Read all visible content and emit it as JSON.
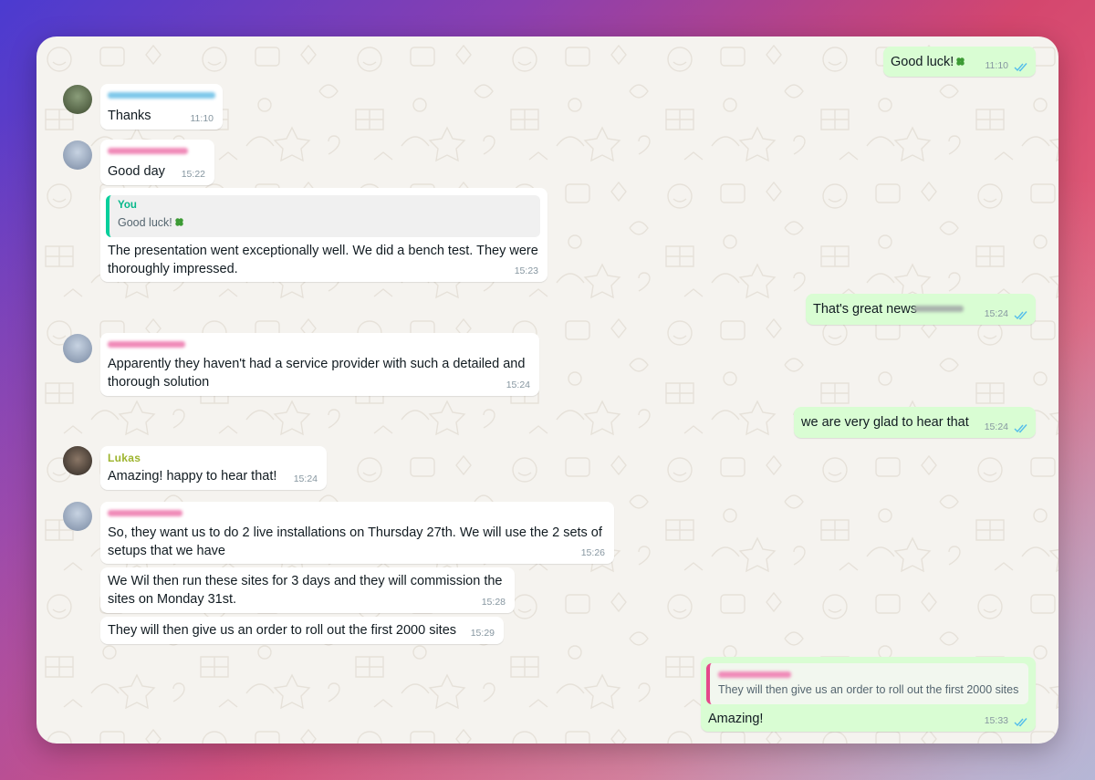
{
  "colors": {
    "outgoing_bubble": "#d9fdd3",
    "incoming_bubble": "#ffffff",
    "read_ticks": "#53bdeb",
    "lukas_name": "#9db42d",
    "quote_you_bar": "#06cf9c",
    "quote_other_bar": "#e5488b"
  },
  "messages": [
    {
      "text": "Good luck!",
      "time": "11:10",
      "emoji": "four-leaf-clover-icon"
    },
    {
      "text": "Thanks",
      "time": "11:10"
    },
    {
      "text": "Good day",
      "time": "15:22"
    },
    {
      "quote_author": "You",
      "quote_text": "Good luck!",
      "line1": "The presentation went exceptionally well. We did a bench test. They were",
      "line2": "thoroughly impressed.",
      "time": "15:23"
    },
    {
      "text": "That's great news",
      "time": "15:24"
    },
    {
      "line1": "Apparently they haven't had a service provider with such a detailed and",
      "line2": "thorough solution",
      "time": "15:24"
    },
    {
      "text": "we are very glad to hear that",
      "time": "15:24"
    },
    {
      "sender": "Lukas",
      "text": "Amazing! happy to hear that!",
      "time": "15:24"
    },
    {
      "line1": "So, they want us to do 2  live installations on Thursday 27th. We will use the 2 sets of",
      "line2": "setups that we have",
      "time": "15:26"
    },
    {
      "line1": "We Wil then run these sites for 3 days and they will commission the",
      "line2": "sites on Monday 31st.",
      "time": "15:28"
    },
    {
      "text": "They will then give us an order to roll out the first 2000 sites",
      "time": "15:29"
    },
    {
      "quote_text": "They will then give us an order to roll out the first 2000 sites",
      "text": "Amazing!",
      "time": "15:33"
    }
  ]
}
